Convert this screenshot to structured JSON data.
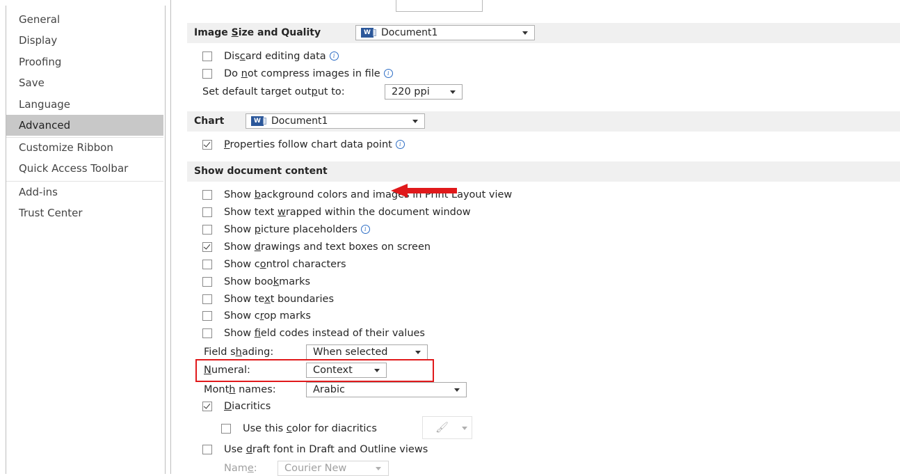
{
  "sidebar": {
    "items": [
      {
        "label": "General"
      },
      {
        "label": "Display"
      },
      {
        "label": "Proofing"
      },
      {
        "label": "Save"
      },
      {
        "label": "Language"
      },
      {
        "label": "Advanced",
        "selected": true
      },
      {
        "label": "Customize Ribbon"
      },
      {
        "label": "Quick Access Toolbar"
      },
      {
        "label": "Add-ins"
      },
      {
        "label": "Trust Center"
      }
    ]
  },
  "image_section": {
    "title_pre": "Image ",
    "title_u": "S",
    "title_post": "ize and Quality",
    "document": "Document1",
    "discard": {
      "pre": "Dis",
      "u": "c",
      "post": "ard editing data",
      "checked": false
    },
    "no_compress": {
      "pre": "Do ",
      "u": "n",
      "post": "ot compress images in file",
      "checked": false
    },
    "target_label_pre": "Set default target out",
    "target_label_u": "p",
    "target_label_post": "ut to:",
    "target_value": "220 ppi"
  },
  "chart_section": {
    "title": "Chart",
    "document": "Document1",
    "properties": {
      "u": "P",
      "post": "roperties follow chart data point",
      "checked": true
    }
  },
  "content_section": {
    "title": "Show document content",
    "options": [
      {
        "pre": "Show ",
        "u": "b",
        "post": "ackground colors and images in Print Layout view",
        "checked": false
      },
      {
        "pre": "Show text ",
        "u": "w",
        "post": "rapped within the document window",
        "checked": false
      },
      {
        "pre": "Show ",
        "u": "p",
        "post": "icture placeholders",
        "checked": false,
        "info": true
      },
      {
        "pre": "Show ",
        "u": "d",
        "post": "rawings and text boxes on screen",
        "checked": true
      },
      {
        "pre": "Show c",
        "u": "o",
        "post": "ntrol characters",
        "checked": false
      },
      {
        "pre": "Show boo",
        "u": "k",
        "post": "marks",
        "checked": false
      },
      {
        "pre": "Show te",
        "u": "x",
        "post": "t boundaries",
        "checked": false
      },
      {
        "pre": "Show c",
        "u": "r",
        "post": "op marks",
        "checked": false
      },
      {
        "pre": "Show ",
        "u": "f",
        "post": "ield codes instead of their values",
        "checked": false
      }
    ],
    "field_shading": {
      "pre": "Field s",
      "u": "h",
      "post": "ading:",
      "value": "When selected"
    },
    "numeral": {
      "pre": "",
      "u": "N",
      "post": "umeral:",
      "value": "Context"
    },
    "month_names": {
      "pre": "Mont",
      "u": "h",
      "post": " names:",
      "value": "Arabic"
    },
    "diacritics": {
      "u": "D",
      "post": "iacritics",
      "checked": true
    },
    "diacritic_color": {
      "pre": "Use this ",
      "u": "c",
      "post": "olor for diacritics",
      "checked": false
    },
    "draft_font": {
      "pre": "Use ",
      "u": "d",
      "post": "raft font in Draft and Outline views",
      "checked": false
    },
    "name": {
      "pre": "Nam",
      "u": "e",
      "post": ":",
      "value": "Courier New"
    }
  },
  "colors": {
    "accent_red": "#e0191b",
    "selected_bg": "#c8c8c8",
    "info_blue": "#2b6cc4"
  }
}
